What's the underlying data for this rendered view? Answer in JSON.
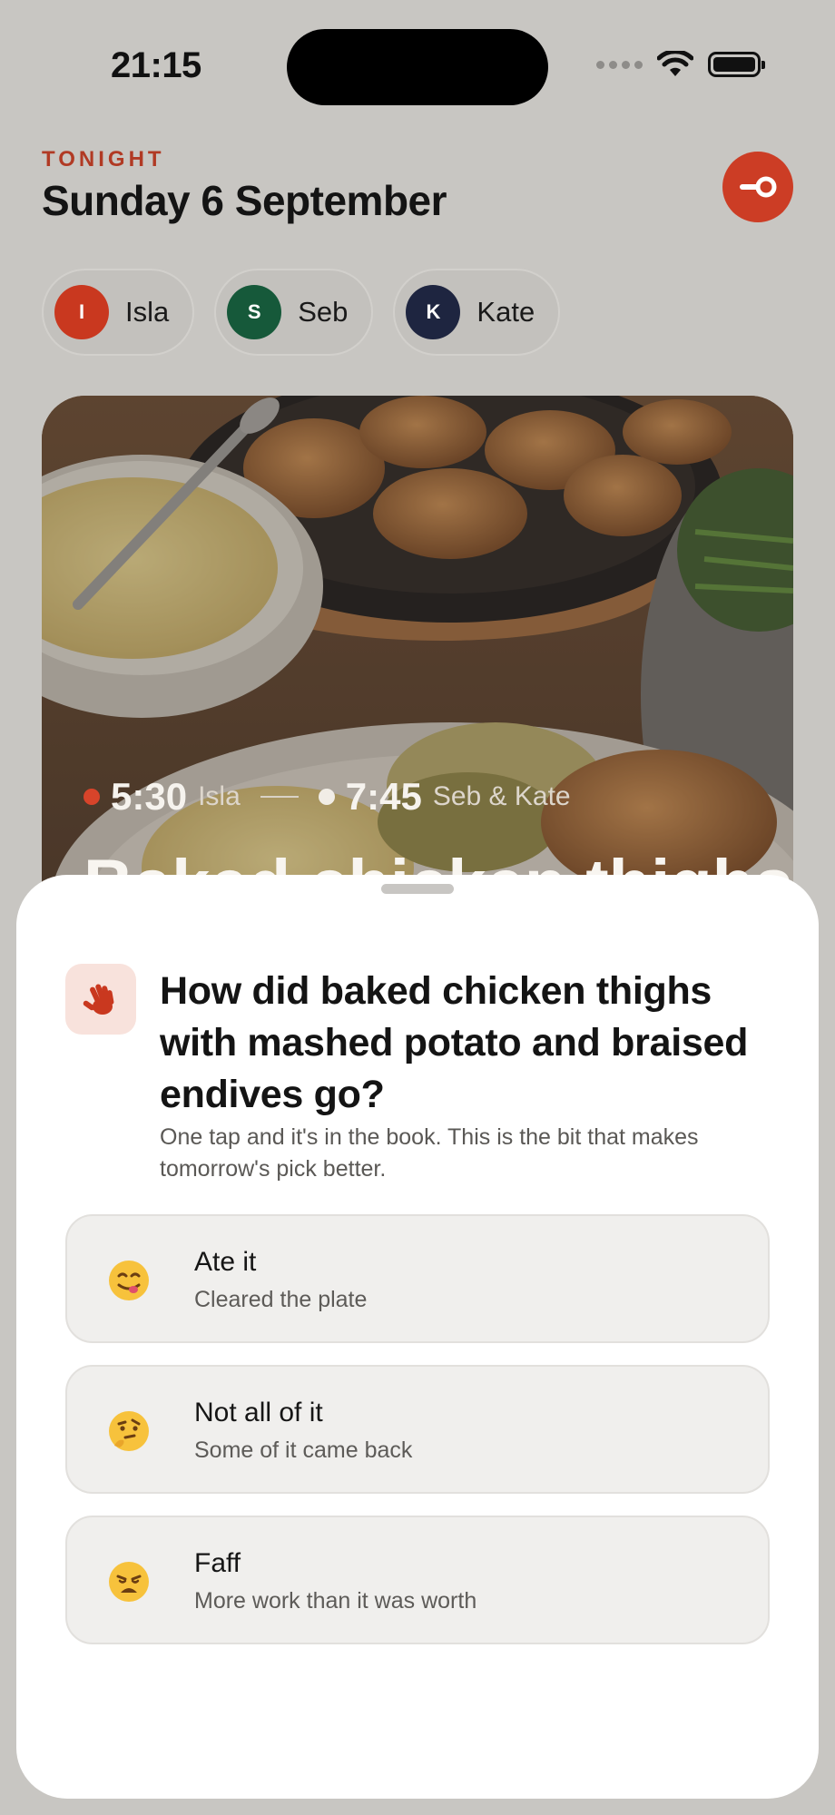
{
  "status_bar": {
    "time": "21:15"
  },
  "header": {
    "eyebrow": "TONIGHT",
    "date": "Sunday 6 September",
    "key_icon": "key-icon",
    "accent_color": "#cc3d25"
  },
  "people": [
    {
      "initial": "I",
      "name": "Isla",
      "color": "#c9381f"
    },
    {
      "initial": "S",
      "name": "Seb",
      "color": "#16593a"
    },
    {
      "initial": "K",
      "name": "Kate",
      "color": "#1e2540"
    }
  ],
  "hero": {
    "time1": "5:30",
    "who1": "Isla",
    "time2": "7:45",
    "who2": "Seb & Kate",
    "title": "Baked chicken thighs",
    "dot1_color": "#d8442a",
    "dot2_color": "#f1ede6"
  },
  "sheet": {
    "icon": "waving-hand-icon",
    "question": "How did baked chicken thighs with mashed potato and braised endives go?",
    "subtext": "One tap and it's in the book. This is the bit that makes tomorrow's pick better.",
    "options": [
      {
        "emoji": "yum-face-icon",
        "title": "Ate it",
        "subtitle": "Cleared the plate"
      },
      {
        "emoji": "thinking-face-icon",
        "title": "Not all of it",
        "subtitle": "Some of it came back"
      },
      {
        "emoji": "weary-face-icon",
        "title": "Faff",
        "subtitle": "More work than it was worth"
      }
    ]
  }
}
